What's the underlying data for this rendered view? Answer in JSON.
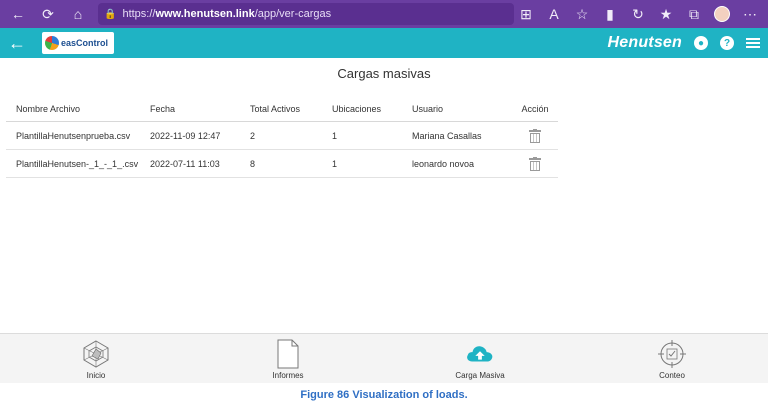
{
  "browser": {
    "url_prefix": "https://",
    "url_host": "www.henutsen.link",
    "url_path": "/app/ver-cargas"
  },
  "header": {
    "logo_text": "easControl",
    "brand": "Henutsen"
  },
  "page": {
    "title": "Cargas masivas"
  },
  "table": {
    "columns": [
      "Nombre Archivo",
      "Fecha",
      "Total Activos",
      "Ubicaciones",
      "Usuario",
      "Acción"
    ],
    "rows": [
      {
        "archivo": "PlantillaHenutsenprueba.csv",
        "fecha": "2022-11-09 12:47",
        "total": "2",
        "ubicaciones": "1",
        "usuario": "Mariana Casallas"
      },
      {
        "archivo": "PlantillaHenutsen-_1_-_1_.csv",
        "fecha": "2022-07-11 11:03",
        "total": "8",
        "ubicaciones": "1",
        "usuario": "leonardo novoa"
      }
    ]
  },
  "bottom_nav": {
    "items": [
      {
        "label": "Inicio",
        "icon": "radar-icon"
      },
      {
        "label": "Informes",
        "icon": "document-icon"
      },
      {
        "label": "Carga Masiva",
        "icon": "cloud-upload-icon"
      },
      {
        "label": "Conteo",
        "icon": "target-icon"
      }
    ]
  },
  "caption": "Figure 86 Visualization of loads.",
  "colors": {
    "browser_bar": "#6a3ea1",
    "header": "#1fb3c4",
    "accent_upload": "#1fb3c4",
    "caption": "#2f6fc4"
  }
}
